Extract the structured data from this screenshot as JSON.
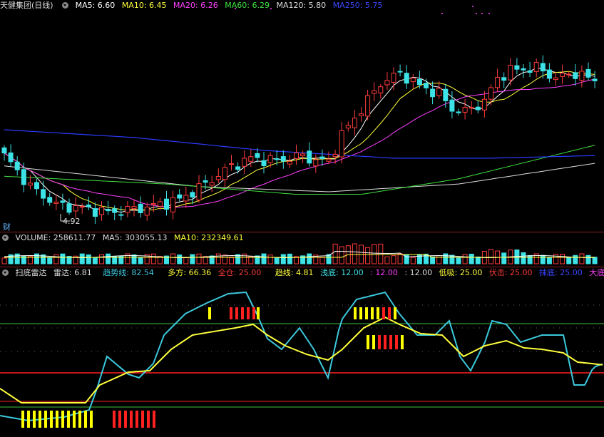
{
  "price_header": {
    "title": "天健集团(日线)",
    "ma5": "MA5: 6.60",
    "ma10": "MA10: 6.45",
    "ma20": "MA20: 6.26",
    "ma60": "MA60: 6.29",
    "ma120": "MA120: 5.80",
    "ma250": "MA250: 5.75"
  },
  "price_panel": {
    "low_marker": "4.92",
    "badge": "财"
  },
  "volume_header": {
    "volume": "VOLUME: 258611.77",
    "ma5": "MA5: 303055.13",
    "ma10": "MA10: 232349.61"
  },
  "radar_header": {
    "name": "扫底雷达",
    "radar": "雷达: 6.81",
    "trend": "趋势线: 82.54",
    "long": "多方: 66.36",
    "full": "全仓: 25.00",
    "trendline": "趋线: 4.81",
    "shallow": "浅底: 12.00",
    "blank1": ": 12.00",
    "blank2": ": 12.00",
    "lowbuy": "低吸: 25.00",
    "ambush": "伏击: 25.00",
    "bottom": "抹底: 25.00",
    "bigbottom": "大底天"
  },
  "colors": {
    "up": "#ff3b3b",
    "down": "#3ce2e6",
    "ma5": "#ffffff",
    "ma10": "#ffff3c",
    "ma20": "#ff40ff",
    "ma60": "#40e040",
    "ma120": "#dddddd",
    "ma250": "#2b3cff",
    "radar": "#3cc8dc",
    "trend": "#ffff3c",
    "bar_yellow": "#ffff00",
    "bar_red": "#ff2020"
  },
  "chart_data": {
    "type": "candlestick",
    "title": "天健集团(日线)",
    "ylim": [
      4.5,
      8.2
    ],
    "low_price": 4.92,
    "moving_averages": {
      "MA5": 6.6,
      "MA10": 6.45,
      "MA20": 6.26,
      "MA60": 6.29,
      "MA120": 5.8,
      "MA250": 5.75
    },
    "volume": {
      "last": 258611.77,
      "ma5": 303055.13,
      "ma10": 232349.61
    },
    "radar": {
      "radar": 6.81,
      "trend": 82.54,
      "long": 66.36,
      "full": 25.0,
      "trendline": 4.81
    }
  }
}
